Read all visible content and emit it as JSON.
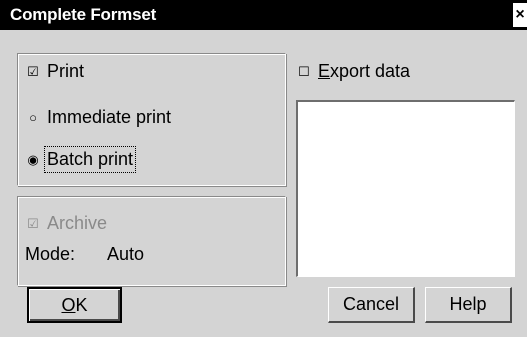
{
  "window": {
    "title": "Complete Formset",
    "close_glyph": "×"
  },
  "print_group": {
    "print": {
      "label": "Print",
      "checked": true
    },
    "immediate": {
      "label": "Immediate print",
      "selected": false
    },
    "batch": {
      "label": "Batch print",
      "selected": true
    }
  },
  "archive_group": {
    "archive": {
      "label": "Archive",
      "checked": true,
      "enabled": false
    },
    "mode_label": "Mode:",
    "mode_value": "Auto"
  },
  "export": {
    "label_mnemonic": "E",
    "label_rest": "xport data",
    "checked": false
  },
  "buttons": {
    "ok_mnemonic": "O",
    "ok_rest": "K",
    "cancel": "Cancel",
    "help": "Help"
  },
  "glyphs": {
    "checkbox_checked": "☑",
    "checkbox_unchecked": "☐",
    "radio_selected": "◉",
    "radio_unselected": "○"
  }
}
